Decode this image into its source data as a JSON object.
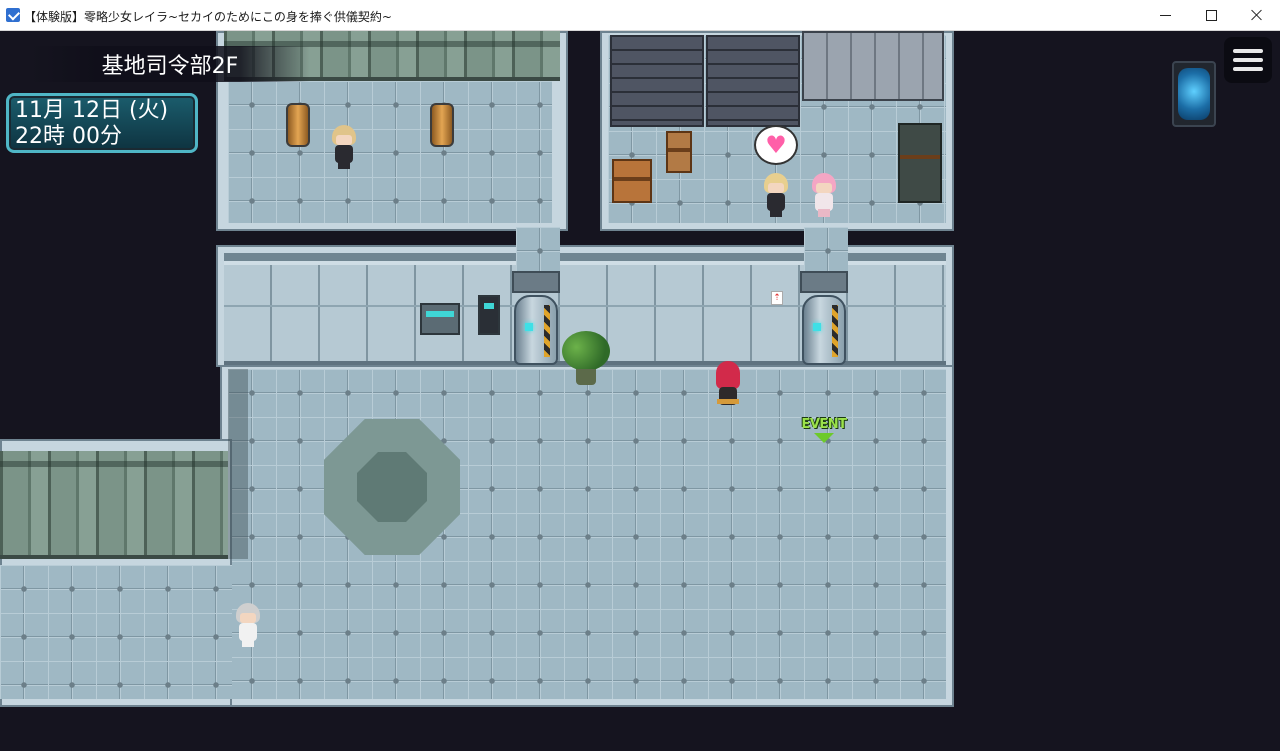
{
  "window": {
    "title": "【体験版】零略少女レイラ~セカイのためにこの身を捧ぐ供儀契約~",
    "controls": {
      "minimize": "minimize",
      "maximize": "maximize",
      "close": "close"
    }
  },
  "hud": {
    "map_name": "基地司令部2F",
    "clock": {
      "date": "11月 12日 (火)",
      "time": "22時 00分"
    }
  },
  "event_marker": {
    "label": "EVENT"
  },
  "icons": {
    "app": "app-icon",
    "menu": "hamburger-menu-icon",
    "orb": "portal-orb-icon",
    "heart": "heart-icon",
    "exit_sign": "exit-sign-icon"
  },
  "glyphs": {
    "heart": "♥",
    "exit": "⇡"
  },
  "colors": {
    "floor": "#9fb8c4",
    "wall": "#b6c9d3",
    "background": "#15141f",
    "clock_border": "#4fb6c6",
    "event_text": "#9be24a",
    "heart": "#ff5fa8"
  }
}
